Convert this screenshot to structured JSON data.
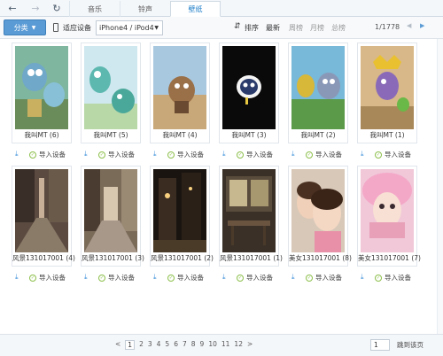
{
  "nav": {
    "tabs": [
      {
        "label": "音乐"
      },
      {
        "label": "铃声"
      },
      {
        "label": "壁纸"
      }
    ]
  },
  "toolbar": {
    "category_label": "分类",
    "adapt_label": "适应设备",
    "device_value": "iPhone4 / iPod4",
    "sort_label": "排序",
    "sort_options": [
      "最新",
      "周榜",
      "月榜",
      "总榜"
    ],
    "page_counter": "1/1778"
  },
  "wallpapers": [
    {
      "caption": "我叫MT (6)",
      "action": "导入设备"
    },
    {
      "caption": "我叫MT (5)",
      "action": "导入设备"
    },
    {
      "caption": "我叫MT (4)",
      "action": "导入设备"
    },
    {
      "caption": "我叫MT (3)",
      "action": "导入设备"
    },
    {
      "caption": "我叫MT (2)",
      "action": "导入设备"
    },
    {
      "caption": "我叫MT (1)",
      "action": "导入设备"
    },
    {
      "caption": "风景131017001 (4)",
      "action": "导入设备"
    },
    {
      "caption": "风景131017001 (3)",
      "action": "导入设备"
    },
    {
      "caption": "风景131017001 (2)",
      "action": "导入设备"
    },
    {
      "caption": "风景131017001 (1)",
      "action": "导入设备"
    },
    {
      "caption": "美女131017001 (8)",
      "action": "导入设备"
    },
    {
      "caption": "美女131017001 (7)",
      "action": "导入设备"
    }
  ],
  "pagination": {
    "prev": "<",
    "pages": [
      "1",
      "2",
      "3",
      "4",
      "5",
      "6",
      "7",
      "8",
      "9",
      "10",
      "11",
      "12"
    ],
    "next": ">",
    "goto_value": "1",
    "goto_label": "跳到该页"
  },
  "colors": {
    "accent": "#5b9bd5",
    "active_tab_text": "#1f7fc9",
    "import_icon": "#8cbf4a"
  },
  "icons": {
    "back": "arrow-left-icon",
    "forward": "arrow-right-icon",
    "refresh": "refresh-icon",
    "download": "download-icon",
    "import": "import-icon",
    "sort": "sort-icon",
    "device": "phone-icon"
  }
}
